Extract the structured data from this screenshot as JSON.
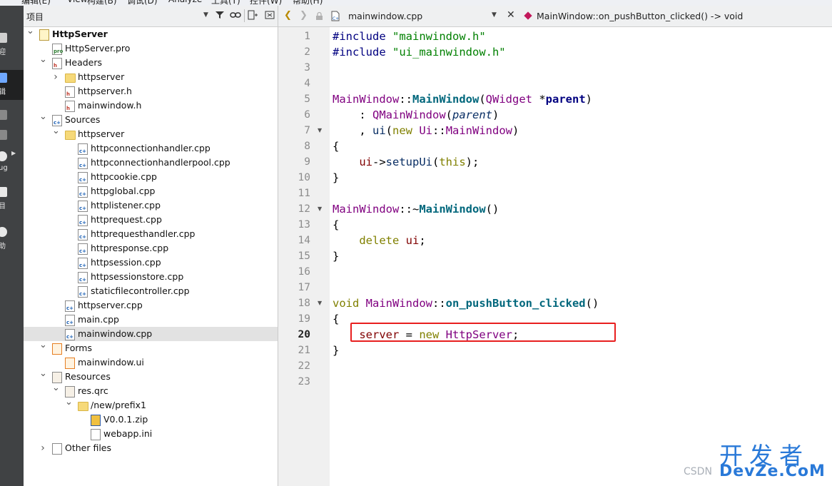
{
  "menubar": {
    "items": [
      "编辑(E)",
      "View",
      "构建(B)",
      "调试(D)",
      "Analyze",
      "工具(T)",
      "控件(W)",
      "帮助(H)"
    ]
  },
  "modebar": {
    "items": [
      {
        "label": "迎",
        "icon": "welcome-icon"
      },
      {
        "label": "辑",
        "icon": "edit-icon"
      },
      {
        "label": "",
        "icon": "design-icon"
      },
      {
        "label": "",
        "icon": "build-icon"
      },
      {
        "label": "ug",
        "icon": "debug-icon"
      },
      {
        "label": "目",
        "icon": "projects-icon"
      },
      {
        "label": "助",
        "icon": "help-icon"
      }
    ]
  },
  "project": {
    "title": "项目",
    "tree": [
      {
        "depth": 0,
        "arrow": "down",
        "icon": "project",
        "label": "HttpServer",
        "bold": true
      },
      {
        "depth": 1,
        "arrow": "",
        "icon": "pro",
        "label": "HttpServer.pro"
      },
      {
        "depth": 1,
        "arrow": "down",
        "icon": "h",
        "label": "Headers"
      },
      {
        "depth": 2,
        "arrow": "right",
        "icon": "folder",
        "label": "httpserver"
      },
      {
        "depth": 2,
        "arrow": "",
        "icon": "h",
        "label": "httpserver.h"
      },
      {
        "depth": 2,
        "arrow": "",
        "icon": "h",
        "label": "mainwindow.h"
      },
      {
        "depth": 1,
        "arrow": "down",
        "icon": "cpp",
        "label": "Sources"
      },
      {
        "depth": 2,
        "arrow": "down",
        "icon": "folder",
        "label": "httpserver"
      },
      {
        "depth": 3,
        "arrow": "",
        "icon": "cpp",
        "label": "httpconnectionhandler.cpp"
      },
      {
        "depth": 3,
        "arrow": "",
        "icon": "cpp",
        "label": "httpconnectionhandlerpool.cpp"
      },
      {
        "depth": 3,
        "arrow": "",
        "icon": "cpp",
        "label": "httpcookie.cpp"
      },
      {
        "depth": 3,
        "arrow": "",
        "icon": "cpp",
        "label": "httpglobal.cpp"
      },
      {
        "depth": 3,
        "arrow": "",
        "icon": "cpp",
        "label": "httplistener.cpp"
      },
      {
        "depth": 3,
        "arrow": "",
        "icon": "cpp",
        "label": "httprequest.cpp"
      },
      {
        "depth": 3,
        "arrow": "",
        "icon": "cpp",
        "label": "httprequesthandler.cpp"
      },
      {
        "depth": 3,
        "arrow": "",
        "icon": "cpp",
        "label": "httpresponse.cpp"
      },
      {
        "depth": 3,
        "arrow": "",
        "icon": "cpp",
        "label": "httpsession.cpp"
      },
      {
        "depth": 3,
        "arrow": "",
        "icon": "cpp",
        "label": "httpsessionstore.cpp"
      },
      {
        "depth": 3,
        "arrow": "",
        "icon": "cpp",
        "label": "staticfilecontroller.cpp"
      },
      {
        "depth": 2,
        "arrow": "",
        "icon": "cpp",
        "label": "httpserver.cpp"
      },
      {
        "depth": 2,
        "arrow": "",
        "icon": "cpp",
        "label": "main.cpp"
      },
      {
        "depth": 2,
        "arrow": "",
        "icon": "cpp",
        "label": "mainwindow.cpp",
        "selected": true
      },
      {
        "depth": 1,
        "arrow": "down",
        "icon": "ui",
        "label": "Forms"
      },
      {
        "depth": 2,
        "arrow": "",
        "icon": "ui",
        "label": "mainwindow.ui"
      },
      {
        "depth": 1,
        "arrow": "down",
        "icon": "res",
        "label": "Resources"
      },
      {
        "depth": 2,
        "arrow": "down",
        "icon": "res",
        "label": "res.qrc"
      },
      {
        "depth": 3,
        "arrow": "down",
        "icon": "folder",
        "label": "/new/prefix1"
      },
      {
        "depth": 4,
        "arrow": "",
        "icon": "zip",
        "label": "V0.0.1.zip"
      },
      {
        "depth": 4,
        "arrow": "",
        "icon": "ini",
        "label": "webapp.ini"
      },
      {
        "depth": 1,
        "arrow": "right",
        "icon": "other",
        "label": "Other files"
      }
    ]
  },
  "editor": {
    "file_name": "mainwindow.cpp",
    "symbol": "MainWindow::on_pushButton_clicked() -> void",
    "current_line": 20,
    "fold_lines": [
      7,
      12,
      18
    ],
    "lines": [
      [
        [
          "pp",
          "#include "
        ],
        [
          "str",
          "\"mainwindow.h\""
        ]
      ],
      [
        [
          "pp",
          "#include "
        ],
        [
          "str",
          "\"ui_mainwindow.h\""
        ]
      ],
      [],
      [],
      [
        [
          "cls",
          "MainWindow"
        ],
        [
          "",
          "::"
        ],
        [
          "fn",
          "MainWindow"
        ],
        [
          "",
          "("
        ],
        [
          "cls",
          "QWidget"
        ],
        [
          "",
          " *"
        ],
        [
          "par",
          "parent"
        ],
        [
          "",
          ")"
        ]
      ],
      [
        [
          "",
          "    : "
        ],
        [
          "cls",
          "QMainWindow"
        ],
        [
          "",
          "("
        ],
        [
          "it",
          "parent"
        ],
        [
          "",
          ")"
        ]
      ],
      [
        [
          "",
          "    , "
        ],
        [
          "par2",
          "ui"
        ],
        [
          "",
          "("
        ],
        [
          "kw",
          "new "
        ],
        [
          "cls",
          "Ui"
        ],
        [
          "",
          "::"
        ],
        [
          "cls",
          "MainWindow"
        ],
        [
          "",
          ")"
        ]
      ],
      [
        [
          "",
          "{"
        ]
      ],
      [
        [
          "",
          "    "
        ],
        [
          "mem",
          "ui"
        ],
        [
          "",
          "->"
        ],
        [
          "par2",
          "setupUi"
        ],
        [
          "",
          "("
        ],
        [
          "kw",
          "this"
        ],
        [
          "",
          ");"
        ]
      ],
      [
        [
          "",
          "}"
        ]
      ],
      [],
      [
        [
          "cls",
          "MainWindow"
        ],
        [
          "",
          "::~"
        ],
        [
          "fn",
          "MainWindow"
        ],
        [
          "",
          "()"
        ]
      ],
      [
        [
          "",
          "{"
        ]
      ],
      [
        [
          "",
          "    "
        ],
        [
          "kw",
          "delete "
        ],
        [
          "mem",
          "ui"
        ],
        [
          "",
          ";"
        ]
      ],
      [
        [
          "",
          "}"
        ]
      ],
      [],
      [],
      [
        [
          "kw",
          "void "
        ],
        [
          "cls",
          "MainWindow"
        ],
        [
          "",
          "::"
        ],
        [
          "fn",
          "on_pushButton_clicked"
        ],
        [
          "",
          "()"
        ]
      ],
      [
        [
          "",
          "{"
        ]
      ],
      [
        [
          "",
          "    "
        ],
        [
          "mem",
          "server"
        ],
        [
          "",
          " = "
        ],
        [
          "kw",
          "new "
        ],
        [
          "cls",
          "HttpServer"
        ],
        [
          "",
          ";"
        ]
      ],
      [
        [
          "",
          "}"
        ]
      ],
      [],
      []
    ]
  },
  "watermark": {
    "cn": "开发者",
    "en": "DevZe.CoM",
    "csdn": "CSDN"
  }
}
